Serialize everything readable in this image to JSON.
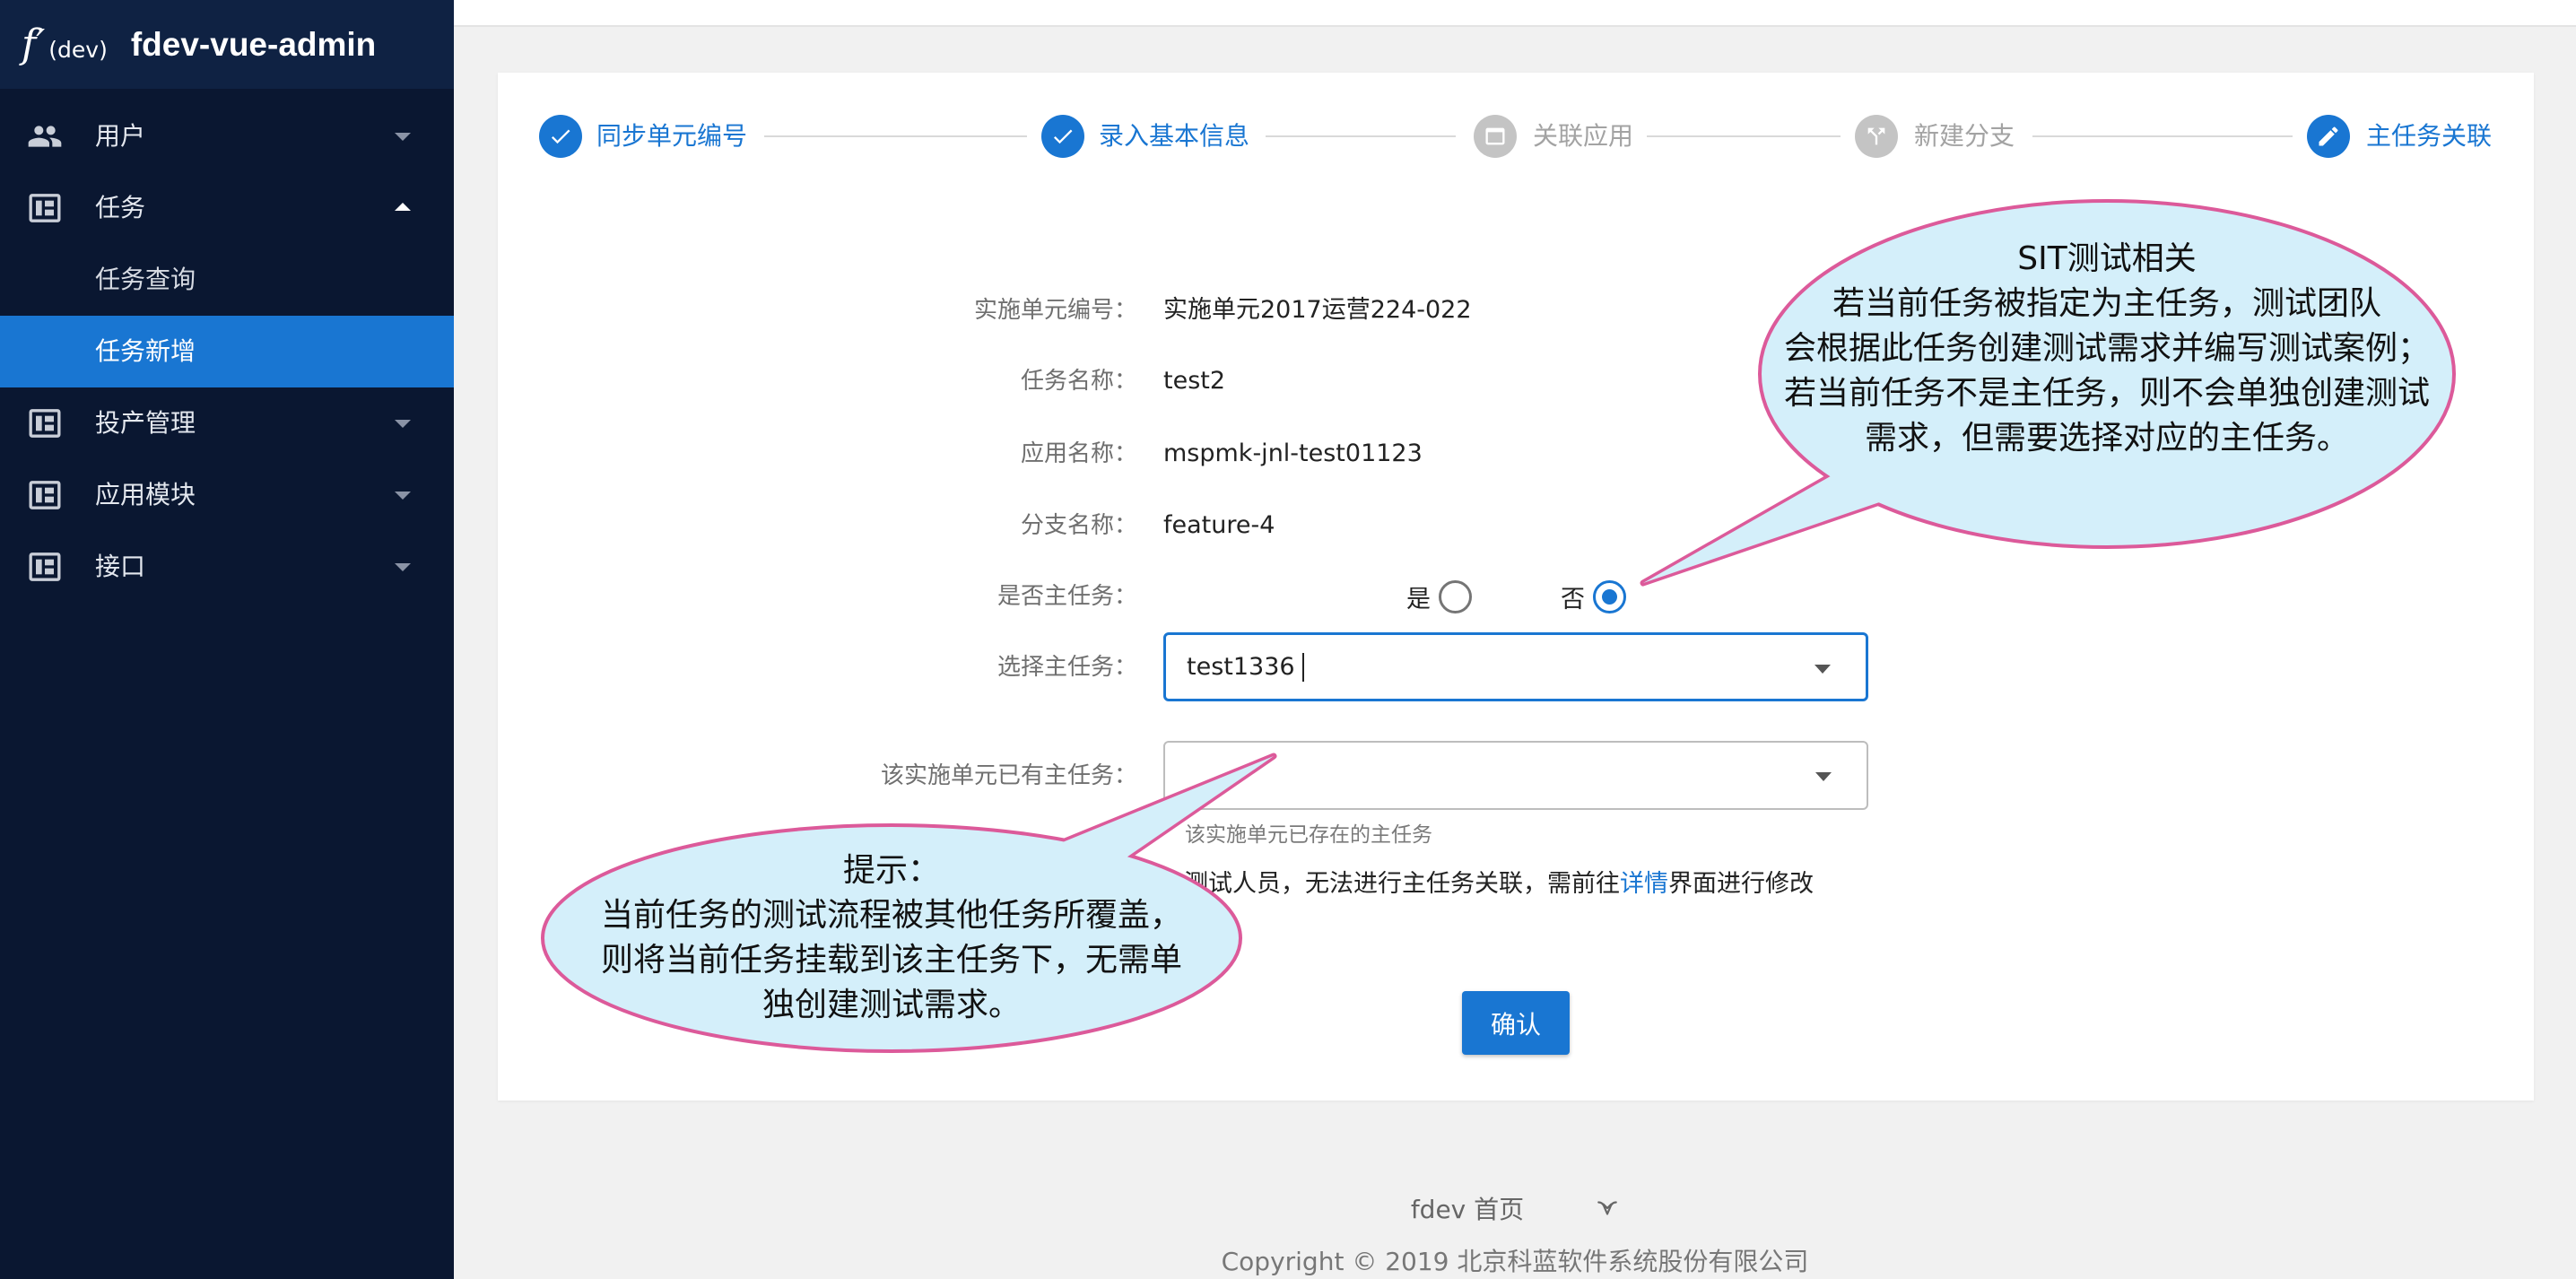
{
  "app": {
    "logo_mark": "f′",
    "logo_sub": "(dev)",
    "title": "fdev-vue-admin"
  },
  "colors": {
    "primary": "#1976d2",
    "sidebar_bg": "#0a1731",
    "bubble_fill": "#d4effa",
    "bubble_stroke": "#dc5a9a"
  },
  "sidebar": {
    "items": [
      {
        "label": "用户",
        "icon": "people-icon",
        "expanded": false
      },
      {
        "label": "任务",
        "icon": "dashboard-icon",
        "expanded": true,
        "children": [
          {
            "label": "任务查询",
            "active": false
          },
          {
            "label": "任务新增",
            "active": true
          }
        ]
      },
      {
        "label": "投产管理",
        "icon": "dashboard-icon",
        "expanded": false
      },
      {
        "label": "应用模块",
        "icon": "dashboard-icon",
        "expanded": false
      },
      {
        "label": "接口",
        "icon": "dashboard-icon",
        "expanded": false
      }
    ]
  },
  "stepper": {
    "steps": [
      {
        "label": "同步单元编号",
        "done": true,
        "active": false,
        "icon": "check-icon"
      },
      {
        "label": "录入基本信息",
        "done": true,
        "active": false,
        "icon": "check-icon"
      },
      {
        "label": "关联应用",
        "done": false,
        "active": false,
        "icon": "web-asset-icon"
      },
      {
        "label": "新建分支",
        "done": false,
        "active": false,
        "icon": "branch-icon"
      },
      {
        "label": "主任务关联",
        "done": false,
        "active": true,
        "icon": "edit-icon"
      }
    ]
  },
  "form": {
    "unit_no": {
      "label": "实施单元编号：",
      "value": "实施单元2017运营224-022"
    },
    "task_name": {
      "label": "任务名称：",
      "value": "test2"
    },
    "app_name": {
      "label": "应用名称：",
      "value": "mspmk-jnl-test01123"
    },
    "branch_name": {
      "label": "分支名称：",
      "value": "feature-4"
    },
    "is_main_task": {
      "label": "是否主任务：",
      "options": [
        {
          "label": "是",
          "selected": false
        },
        {
          "label": "否",
          "selected": true
        }
      ]
    },
    "select_main_task": {
      "label": "选择主任务：",
      "value": "test1336"
    },
    "existing_main_task": {
      "label": "该实施单元已有主任务：",
      "hint": "该实施单元已存在的主任务"
    },
    "notice": {
      "text_before": "测试人员，无法进行主任务关联，需前往",
      "link": "详情",
      "text_after": "界面进行修改"
    },
    "confirm_label": "确认"
  },
  "annotations": {
    "sit": {
      "lines": [
        "SIT测试相关",
        "若当前任务被指定为主任务，测试团队",
        "会根据此任务创建测试需求并编写测试案例；",
        "若当前任务不是主任务，则不会单独创建测试",
        "需求，但需要选择对应的主任务。"
      ]
    },
    "tip": {
      "lines": [
        "提示：",
        "当前任务的测试流程被其他任务所覆盖，",
        "则将当前任务挂载到该主任务下，无需单",
        "独创建测试需求。"
      ]
    }
  },
  "footer": {
    "home_link": "fdev 首页",
    "icon": "logo-icon",
    "copyright": "Copyright © 2019 北京科蓝软件系统股份有限公司"
  }
}
